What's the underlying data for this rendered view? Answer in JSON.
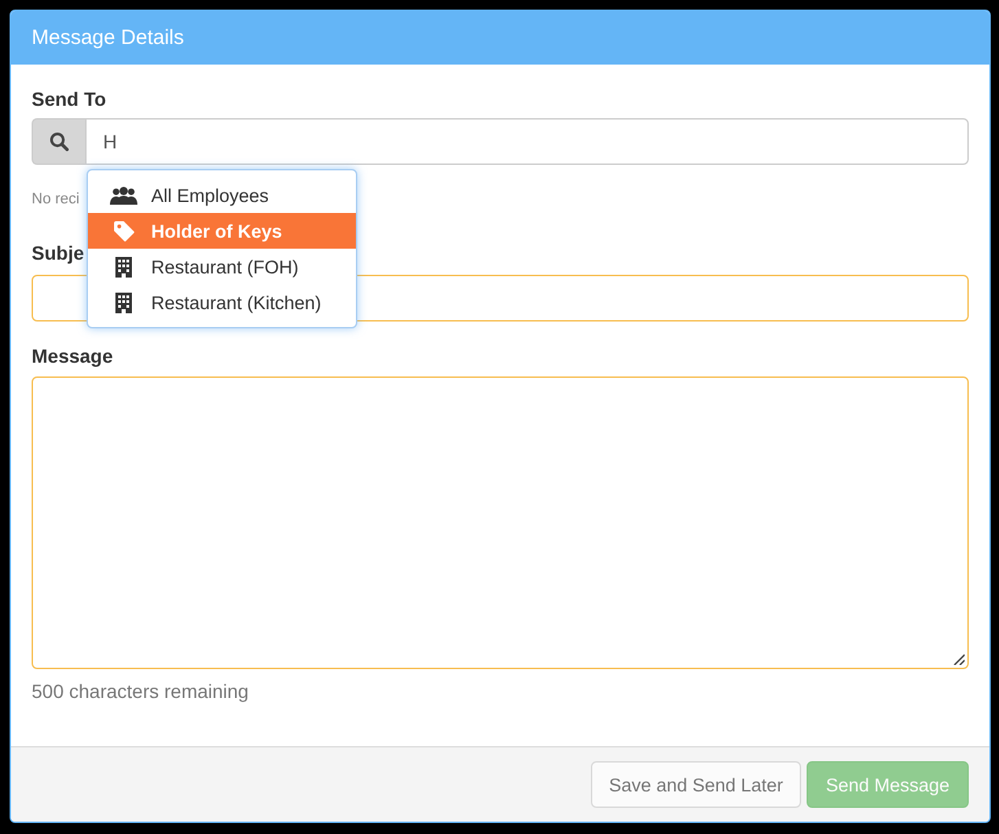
{
  "panel": {
    "title": "Message Details"
  },
  "send_to": {
    "label": "Send To",
    "value": "H",
    "invalid": false,
    "hint": "No reci"
  },
  "dropdown": {
    "items": [
      {
        "label": "All Employees",
        "kind": "group",
        "selected": false
      },
      {
        "label": "Holder of Keys",
        "kind": "tag",
        "selected": true
      },
      {
        "label": "Restaurant (FOH)",
        "kind": "building",
        "selected": false
      },
      {
        "label": "Restaurant (Kitchen)",
        "kind": "building",
        "selected": false
      }
    ]
  },
  "subject": {
    "label": "Subje",
    "invalid": true
  },
  "message": {
    "label": "Message",
    "invalid": true,
    "counter": "500 characters remaining"
  },
  "footer": {
    "buttons": [
      {
        "label": "Save and Send Later",
        "kind": "default",
        "disabled": true
      },
      {
        "label": "Send Message",
        "kind": "success",
        "disabled": true
      }
    ]
  }
}
